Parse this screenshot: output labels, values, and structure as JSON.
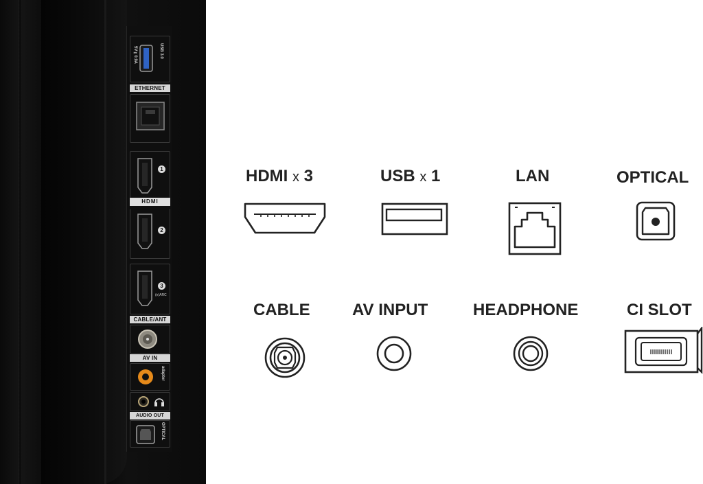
{
  "tv_panel": {
    "usb_label": "USB 3.0",
    "usb_power": "5V⎓0.9A",
    "ethernet_label": "ETHERNET",
    "hdmi_label": "HDMI",
    "hdmi_ports": [
      "1",
      "2",
      "3"
    ],
    "hdmi_earc": "(e)ARC",
    "cable_label": "CABLE/ANT",
    "av_label": "AV IN",
    "av_adapter": "adapter",
    "audio_out_label": "AUDIO OUT",
    "optical_label": "OPTICAL"
  },
  "features": {
    "row1": [
      {
        "name": "HDMI",
        "multiplier": "x",
        "count": "3",
        "icon": "hdmi-port-icon"
      },
      {
        "name": "USB",
        "multiplier": "x",
        "count": "1",
        "icon": "usb-port-icon"
      },
      {
        "name": "LAN",
        "icon": "lan-port-icon"
      },
      {
        "name": "OPTICAL",
        "icon": "optical-port-icon"
      }
    ],
    "row2": [
      {
        "name": "CABLE",
        "icon": "coax-port-icon"
      },
      {
        "name": "AV INPUT",
        "icon": "av-input-icon"
      },
      {
        "name": "HEADPHONE",
        "icon": "headphone-jack-icon"
      },
      {
        "name": "CI SLOT",
        "icon": "ci-slot-icon"
      }
    ]
  }
}
